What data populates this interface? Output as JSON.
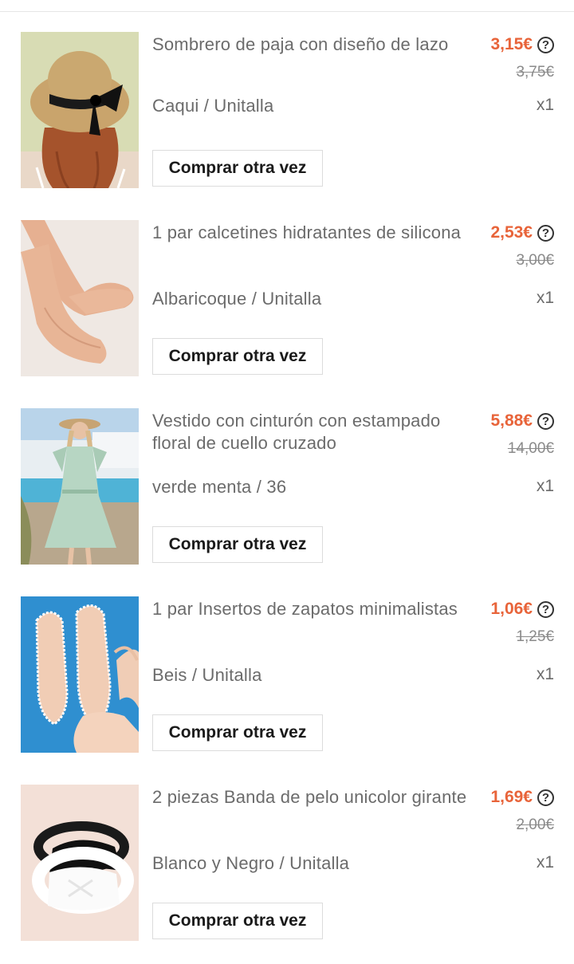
{
  "items": [
    {
      "title": "Sombrero de paja con diseño de lazo",
      "price": "3,15€",
      "original_price": "3,75€",
      "variant": "Caqui / Unitalla",
      "quantity": "x1",
      "button_label": "Comprar otra vez",
      "image": "straw-hat-photo"
    },
    {
      "title": "1 par calcetines hidratantes de silicona",
      "price": "2,53€",
      "original_price": "3,00€",
      "variant": "Albaricoque / Unitalla",
      "quantity": "x1",
      "button_label": "Comprar otra vez",
      "image": "silicone-socks-photo"
    },
    {
      "title": "Vestido con cinturón con estampado floral de cuello cruzado",
      "price": "5,88€",
      "original_price": "14,00€",
      "variant": "verde menta / 36",
      "quantity": "x1",
      "button_label": "Comprar otra vez",
      "image": "floral-dress-photo"
    },
    {
      "title": "1 par Insertos de zapatos minimalistas",
      "price": "1,06€",
      "original_price": "1,25€",
      "variant": "Beis / Unitalla",
      "quantity": "x1",
      "button_label": "Comprar otra vez",
      "image": "shoe-inserts-photo"
    },
    {
      "title": "2 piezas Banda de pelo unicolor girante",
      "price": "1,69€",
      "original_price": "2,00€",
      "variant": "Blanco y Negro / Unitalla",
      "quantity": "x1",
      "button_label": "Comprar otra vez",
      "image": "headband-photo"
    }
  ],
  "help_icon_glyph": "?",
  "colors": {
    "price": "#e8643a",
    "text_secondary": "#6b6b6b",
    "border": "#dcdcdc"
  }
}
